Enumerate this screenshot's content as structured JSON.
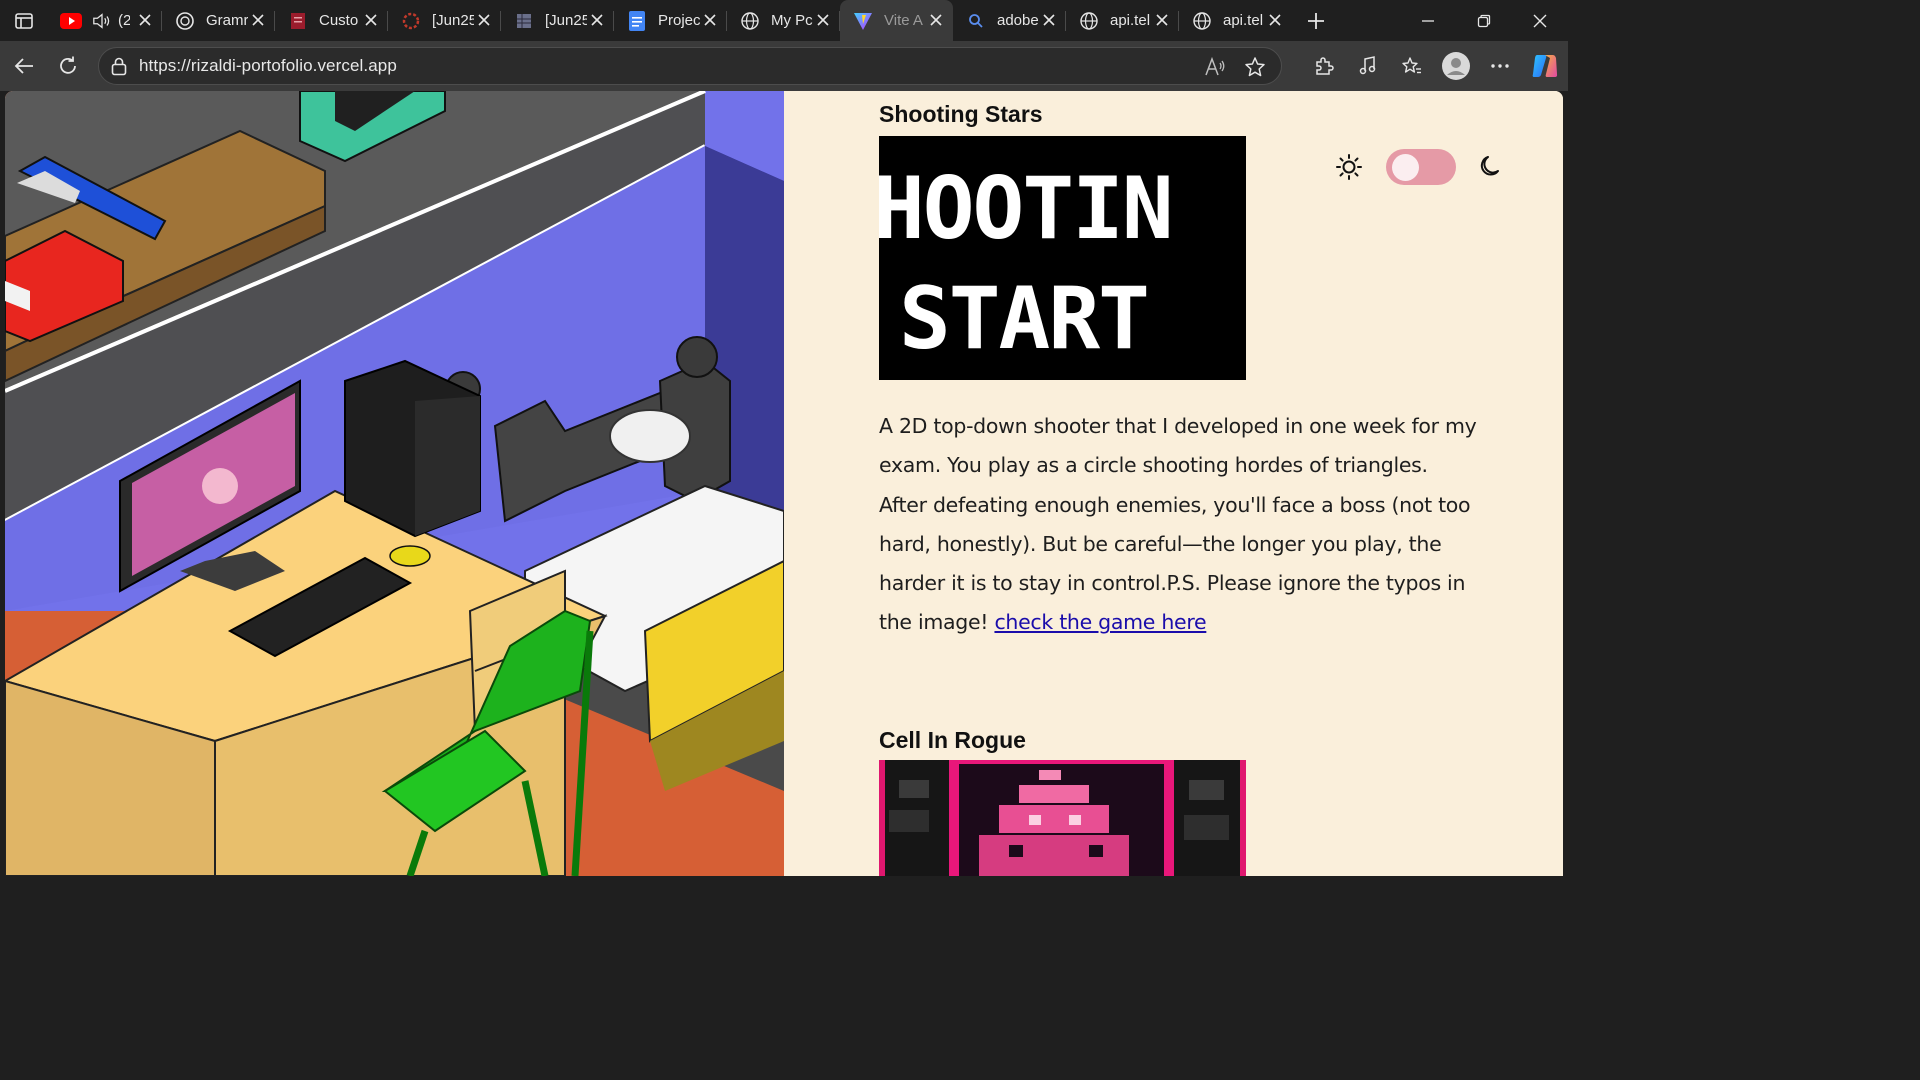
{
  "browser": {
    "tabs": [
      {
        "title": "(2",
        "icon": "youtube-icon",
        "audio": true,
        "color": "#ff0000"
      },
      {
        "title": "Gramr",
        "icon": "openai-icon"
      },
      {
        "title": "Custo",
        "icon": "doc-red-icon",
        "color": "#9b1c2c"
      },
      {
        "title": "[Jun25",
        "icon": "spinner-icon",
        "color": "#c0392b"
      },
      {
        "title": "[Jun25",
        "icon": "sheet-icon"
      },
      {
        "title": "Projec",
        "icon": "google-docs-icon",
        "color": "#4285f4"
      },
      {
        "title": "My Pc",
        "icon": "globe-icon"
      },
      {
        "title": "Vite A",
        "icon": "vite-icon",
        "active": true
      },
      {
        "title": "adobe",
        "icon": "search-icon"
      },
      {
        "title": "api.tel",
        "icon": "globe-icon"
      },
      {
        "title": "api.tel",
        "icon": "globe-icon"
      }
    ],
    "address": {
      "url": "https://rizaldi-portofolio.vercel.app"
    }
  },
  "page": {
    "projects": [
      {
        "title": "Shooting Stars",
        "cover_text_line1": "HOOTIN",
        "cover_text_line2": "START",
        "description_text": "A 2D top-down shooter that I developed in one week for my exam. You play as a circle shooting hordes of triangles. After defeating enough enemies, you'll face a boss (not too hard, honestly). But be careful—the longer you play, the harder it is to stay in control.P.S. Please ignore the typos in the image!",
        "link_label": "check the game here"
      },
      {
        "title": "Cell In Rogue"
      }
    ],
    "theme_toggle": {
      "state": "light"
    }
  },
  "colors": {
    "page_bg": "#faefdb",
    "toggle_track": "#e59aa6",
    "link": "#1a0dab"
  }
}
